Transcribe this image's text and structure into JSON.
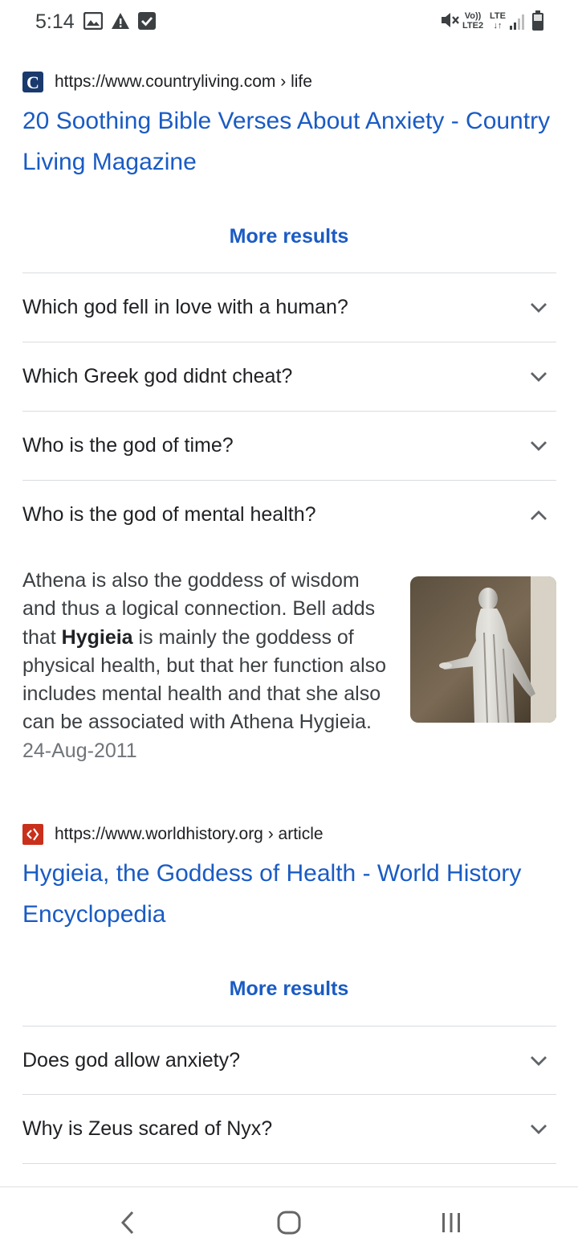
{
  "status_bar": {
    "time": "5:14",
    "icons_left": [
      "image-icon",
      "warning-icon",
      "checkbox-icon"
    ],
    "icons_right": [
      "mute-icon",
      "volte-icon",
      "lte-icon",
      "signal-icon",
      "battery-icon"
    ],
    "volte_label": "Vo))",
    "lte2_label": "LTE2",
    "lte_label": "LTE"
  },
  "result1": {
    "favicon_letter": "C",
    "favicon_color": "#1a3a6e",
    "url": "https://www.countryliving.com › life",
    "title": "20 Soothing Bible Verses About Anxiety - Country Living Magazine"
  },
  "more_results_1": "More results",
  "faq": [
    {
      "question": "Which god fell in love with a human?",
      "expanded": false
    },
    {
      "question": "Which Greek god didnt cheat?",
      "expanded": false
    },
    {
      "question": "Who is the god of time?",
      "expanded": false
    },
    {
      "question": "Who is the god of mental health?",
      "expanded": true
    }
  ],
  "answer": {
    "text_before": "Athena is also the goddess of wisdom and thus a logical connection. Bell adds that ",
    "bold": "Hygieia",
    "text_after": " is mainly the goddess of physical health, but that her function also includes mental health and that she also can be associated with Athena Hygieia.",
    "date": "24-Aug-2011",
    "image": "statue-of-hygieia"
  },
  "result2": {
    "favicon_color": "#c9301c",
    "url": "https://www.worldhistory.org › article",
    "title": "Hygieia, the Goddess of Health - World History Encyclopedia"
  },
  "more_results_2": "More results",
  "faq2": [
    {
      "question": "Does god allow anxiety?",
      "expanded": false
    },
    {
      "question": "Why is Zeus scared of Nyx?",
      "expanded": false
    }
  ],
  "nav": [
    "back-icon",
    "home-icon",
    "recents-icon"
  ],
  "colors": {
    "link": "#1a5bc4",
    "text": "#202124",
    "divider": "#dadce0",
    "date": "#70757a"
  }
}
